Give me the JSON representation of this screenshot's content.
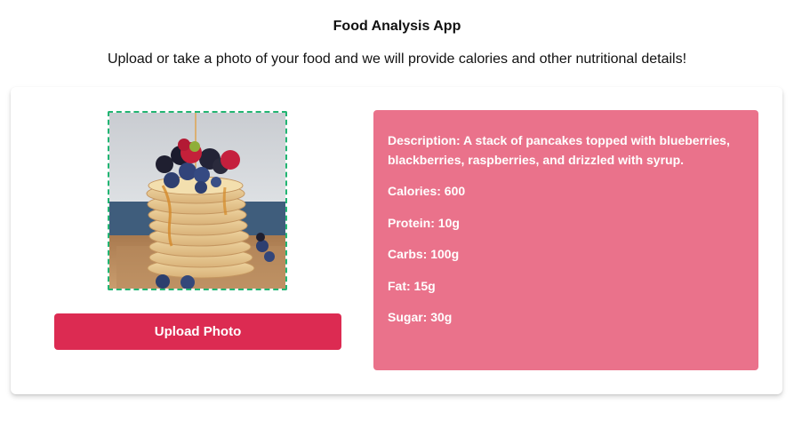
{
  "app": {
    "title": "Food Analysis App",
    "subtitle": "Upload or take a photo of your food and we will provide calories and other nutritional details!"
  },
  "photo": {
    "icon": "pancake-stack-photo",
    "alt": "Food photo"
  },
  "upload": {
    "label": "Upload Photo"
  },
  "results": {
    "description": "Description: A stack of pancakes topped with blueberries, blackberries, raspberries, and drizzled with syrup.",
    "calories": "Calories: 600",
    "protein": "Protein: 10g",
    "carbs": "Carbs: 100g",
    "fat": "Fat: 15g",
    "sugar": "Sugar: 30g"
  },
  "colors": {
    "button": "#dc2b52",
    "panel": "#ea728b",
    "photo_border": "#22b573"
  }
}
